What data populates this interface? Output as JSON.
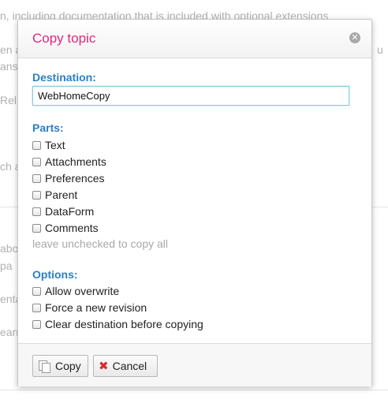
{
  "background": {
    "fragments": [
      "n, including documentation that is included with optional extensions",
      "en a",
      "ans",
      "Rel",
      "ch a",
      "abo",
      "pa",
      "enta",
      "earn",
      "u"
    ]
  },
  "dialog": {
    "title": "Copy topic",
    "close_icon": "close-icon",
    "destination": {
      "label": "Destination:",
      "value": "WebHomeCopy"
    },
    "parts": {
      "label": "Parts:",
      "items": [
        "Text",
        "Attachments",
        "Preferences",
        "Parent",
        "DataForm",
        "Comments"
      ],
      "hint": "leave unchecked to copy all"
    },
    "options": {
      "label": "Options:",
      "items": [
        "Allow overwrite",
        "Force a new revision",
        "Clear destination before copying"
      ]
    },
    "buttons": {
      "copy": {
        "label": "Copy",
        "icon": "copy-icon"
      },
      "cancel": {
        "label": "Cancel",
        "icon": "cancel-icon"
      }
    },
    "colors": {
      "title": "#e0287e",
      "section_label": "#2b7fc8",
      "input_border": "#7ecfd6"
    }
  }
}
